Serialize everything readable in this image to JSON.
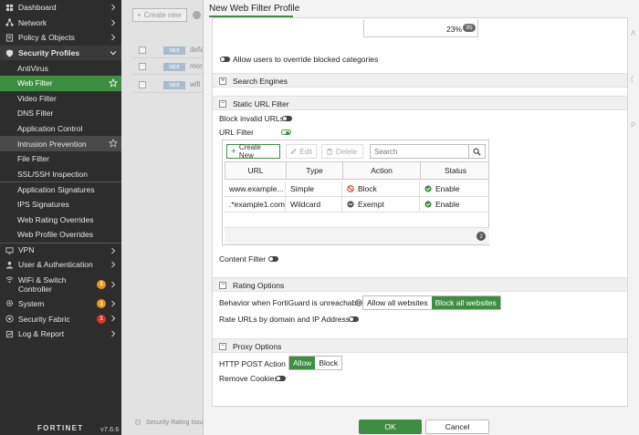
{
  "sidebar": {
    "items": [
      {
        "label": "Dashboard",
        "icon": "dashboard-icon"
      },
      {
        "label": "Network",
        "icon": "network-icon"
      },
      {
        "label": "Policy & Objects",
        "icon": "policy-icon"
      },
      {
        "label": "Security Profiles",
        "icon": "shield-icon"
      },
      {
        "label": "AntiVirus"
      },
      {
        "label": "Web Filter"
      },
      {
        "label": "Video Filter"
      },
      {
        "label": "DNS Filter"
      },
      {
        "label": "Application Control"
      },
      {
        "label": "Intrusion Prevention"
      },
      {
        "label": "File Filter"
      },
      {
        "label": "SSL/SSH Inspection"
      },
      {
        "label": "Application Signatures"
      },
      {
        "label": "IPS Signatures"
      },
      {
        "label": "Web Rating Overrides"
      },
      {
        "label": "Web Profile Overrides"
      },
      {
        "label": "VPN",
        "icon": "vpn-icon"
      },
      {
        "label": "User & Authentication",
        "icon": "user-icon"
      },
      {
        "label": "WiFi & Switch\nController",
        "icon": "wifi-icon",
        "badge": "1"
      },
      {
        "label": "System",
        "icon": "gear-icon",
        "badge": "1"
      },
      {
        "label": "Security Fabric",
        "icon": "fabric-icon",
        "badge": "1"
      },
      {
        "label": "Log & Report",
        "icon": "log-icon"
      }
    ],
    "brand": "FORTINET",
    "version": "v7.6.6",
    "colors": {
      "active": "#3e8e41",
      "badge_orange": "#e8941a",
      "badge_red": "#d9342b"
    }
  },
  "background": {
    "create_button": "Create new",
    "rows": [
      "defa",
      "moni",
      "wifi"
    ],
    "tag": "WEB",
    "bottom_text": "Security Rating Issu"
  },
  "dialog": {
    "title": "New Web Filter Profile",
    "percent": {
      "value": "23%",
      "badge": "95"
    },
    "allow_override_label": "Allow users to override blocked categories",
    "sections": {
      "search_engines": "Search Engines",
      "static_url_filter": "Static URL Filter",
      "rating_options": "Rating Options",
      "proxy_options": "Proxy Options"
    },
    "block_invalid_urls": "Block invalid URLs",
    "url_filter": "URL Filter",
    "toolbar": {
      "create_new": "Create New",
      "edit": "Edit",
      "delete": "Delete",
      "search_placeholder": "Search"
    },
    "table": {
      "headers": [
        "URL",
        "Type",
        "Action",
        "Status"
      ],
      "rows": [
        {
          "url": "www.example...",
          "type": "Simple",
          "action": "Block",
          "status": "Enable"
        },
        {
          "url": ".*example1.com",
          "type": "Wildcard",
          "action": "Exempt",
          "status": "Enable"
        }
      ],
      "count": "2"
    },
    "content_filter": "Content Filter",
    "fortiguard_label": "Behavior when FortiGuard is unreachable",
    "fortiguard_options": [
      "Allow all websites",
      "Block all websites"
    ],
    "rate_urls_label": "Rate URLs by domain and IP Address",
    "http_post_label": "HTTP POST Action",
    "http_post_options": [
      "Allow",
      "Block"
    ],
    "remove_cookies_label": "Remove Cookies",
    "ok": "OK",
    "cancel": "Cancel",
    "gutter": [
      "A",
      "(",
      "P"
    ]
  }
}
